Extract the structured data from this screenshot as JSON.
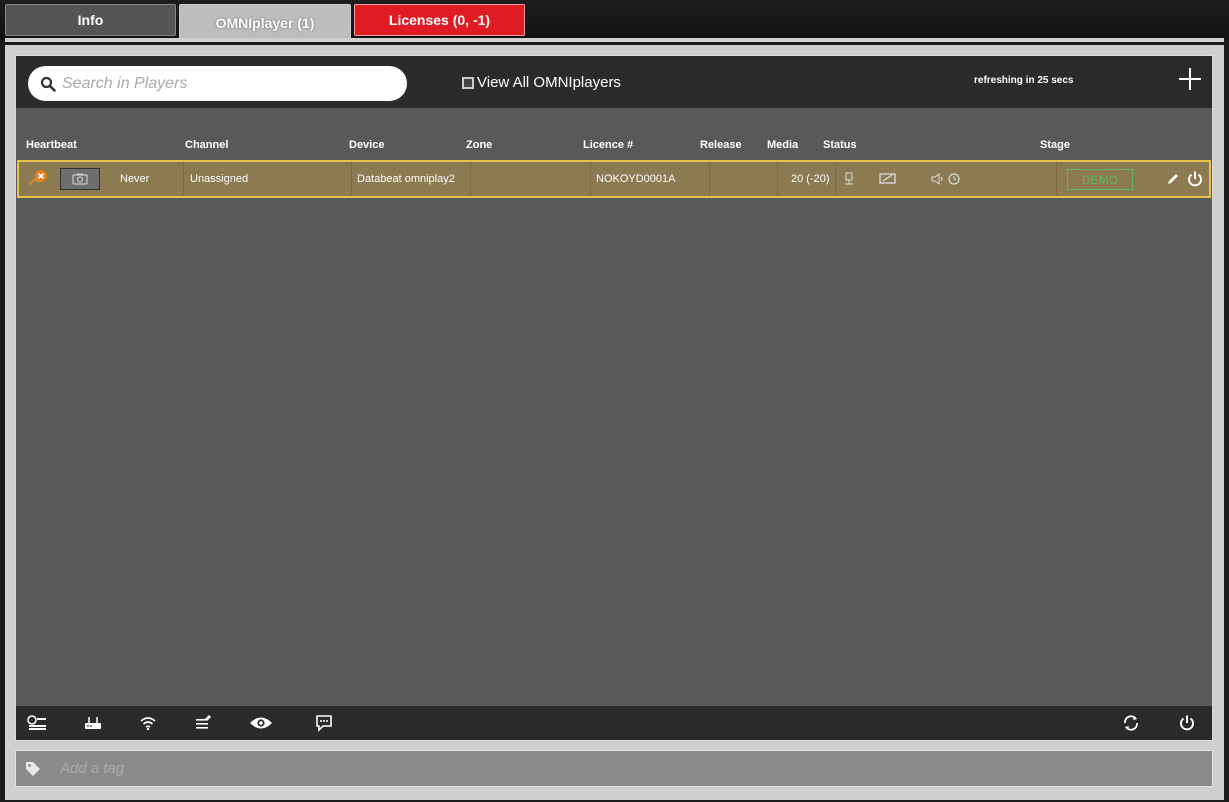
{
  "tabs": [
    {
      "label": "Info"
    },
    {
      "label": "OMNIplayer (1)"
    },
    {
      "label": "Licenses (0, -1)"
    }
  ],
  "toolbar": {
    "search_placeholder": "Search in Players",
    "view_all_label": "View All OMNIplayers",
    "refresh_text": "refreshing in 25 secs"
  },
  "columns": {
    "heartbeat": "Heartbeat",
    "channel": "Channel",
    "device": "Device",
    "zone": "Zone",
    "licence": "Licence #",
    "release": "Release",
    "media": "Media",
    "status": "Status",
    "stage": "Stage"
  },
  "players": [
    {
      "heartbeat": "Never",
      "channel": "Unassigned",
      "device": "Databeat omniplay2",
      "zone": "",
      "licence": "NOKOYD0001A",
      "release": "",
      "media": "20 (-20)",
      "stage": "DEMO",
      "status_icons": [
        "network-icon",
        "display-icon",
        "volume-icon",
        "clock-icon"
      ]
    }
  ],
  "footer_icons": [
    "monitor-list-icon",
    "router-icon",
    "wifi-icon",
    "edit-list-icon",
    "eye-icon",
    "message-icon",
    "sync-icon",
    "power-icon"
  ],
  "tag_placeholder": "Add a tag",
  "colors": {
    "row_bg": "#8b7a52",
    "row_border": "#e6c24a",
    "license_tab": "#e01b24",
    "demo": "#5cb85c"
  }
}
